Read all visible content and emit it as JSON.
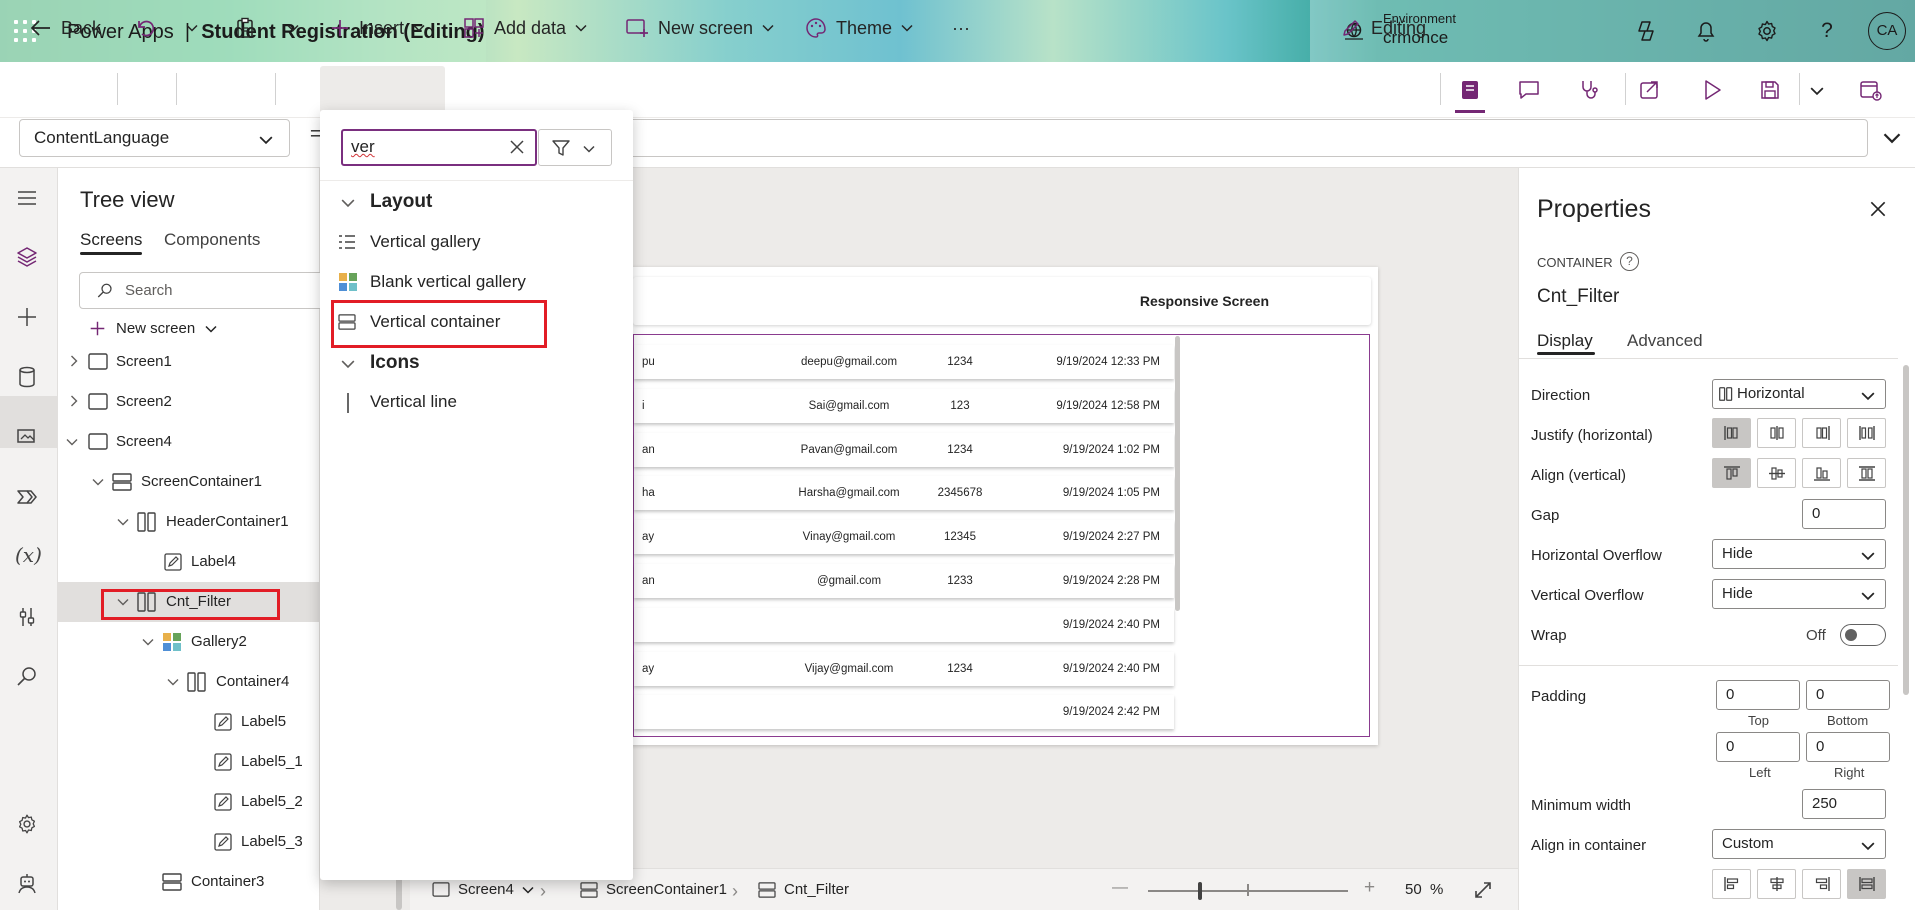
{
  "header": {
    "app_name": "Power Apps",
    "separator": "|",
    "doc_title": "Student Registration (Editing)",
    "environment_label": "Environment",
    "environment_name": "crmonce",
    "avatar_initials": "CA",
    "icons": [
      "app-launcher-icon",
      "environment-icon",
      "copilot-icon",
      "bell-icon",
      "gear-icon",
      "help-icon"
    ]
  },
  "commandbar": {
    "back": "Back",
    "insert": "Insert",
    "add_data": "Add data",
    "new_screen": "New screen",
    "theme": "Theme",
    "more": "···",
    "editing": "Editing"
  },
  "formula": {
    "property": "ContentLanguage",
    "equals": "="
  },
  "tree": {
    "title": "Tree view",
    "tabs": [
      "Screens",
      "Components"
    ],
    "search_placeholder": "Search",
    "new_screen": "New screen",
    "nodes": [
      {
        "label": "Screen1"
      },
      {
        "label": "Screen2"
      },
      {
        "label": "Screen4"
      },
      {
        "label": "ScreenContainer1"
      },
      {
        "label": "HeaderContainer1"
      },
      {
        "label": "Label4"
      },
      {
        "label": "Cnt_Filter"
      },
      {
        "label": "Gallery2"
      },
      {
        "label": "Container4"
      },
      {
        "label": "Label5"
      },
      {
        "label": "Label5_1"
      },
      {
        "label": "Label5_2"
      },
      {
        "label": "Label5_3"
      },
      {
        "label": "Container3"
      }
    ]
  },
  "insert_panel": {
    "search_value": "ver",
    "sections": [
      {
        "title": "Layout",
        "items": [
          "Vertical gallery",
          "Blank vertical gallery",
          "Vertical container"
        ]
      },
      {
        "title": "Icons",
        "items": [
          "Vertical line"
        ]
      }
    ]
  },
  "canvas": {
    "screen_title": "Responsive Screen",
    "rows": [
      {
        "name": "pu",
        "email": "deepu@gmail.com",
        "code": "1234",
        "date": "9/19/2024 12:33 PM"
      },
      {
        "name": "i",
        "email": "Sai@gmail.com",
        "code": "123",
        "date": "9/19/2024 12:58 PM"
      },
      {
        "name": "an",
        "email": "Pavan@gmail.com",
        "code": "1234",
        "date": "9/19/2024 1:02 PM"
      },
      {
        "name": "ha",
        "email": "Harsha@gmail.com",
        "code": "2345678",
        "date": "9/19/2024 1:05 PM"
      },
      {
        "name": "ay",
        "email": "Vinay@gmail.com",
        "code": "12345",
        "date": "9/19/2024 2:27 PM"
      },
      {
        "name": "an",
        "email": "@gmail.com",
        "code": "1233",
        "date": "9/19/2024 2:28 PM"
      },
      {
        "name": "",
        "email": "",
        "code": "",
        "date": "9/19/2024 2:40 PM"
      },
      {
        "name": "ay",
        "email": "Vijay@gmail.com",
        "code": "1234",
        "date": "9/19/2024 2:40 PM"
      },
      {
        "name": "",
        "email": "",
        "code": "",
        "date": "9/19/2024 2:42 PM"
      }
    ]
  },
  "footer": {
    "screen": "Screen4",
    "container": "ScreenContainer1",
    "control": "Cnt_Filter",
    "zoom_minus": "—",
    "zoom_plus": "+",
    "zoom_value": "50",
    "zoom_unit": "%"
  },
  "properties": {
    "title": "Properties",
    "type": "CONTAINER",
    "name": "Cnt_Filter",
    "tabs": [
      "Display",
      "Advanced"
    ],
    "direction_label": "Direction",
    "direction_value": "Horizontal",
    "justify_label": "Justify (horizontal)",
    "align_label": "Align (vertical)",
    "gap_label": "Gap",
    "gap_value": "0",
    "hoverflow_label": "Horizontal Overflow",
    "hoverflow_value": "Hide",
    "voverflow_label": "Vertical Overflow",
    "voverflow_value": "Hide",
    "wrap_label": "Wrap",
    "wrap_value": "Off",
    "padding_label": "Padding",
    "padding": {
      "top": "0",
      "bottom": "0",
      "left": "0",
      "right": "0"
    },
    "padding_captions": {
      "top": "Top",
      "bottom": "Bottom",
      "left": "Left",
      "right": "Right"
    },
    "minwidth_label": "Minimum width",
    "minwidth_value": "250",
    "align_in_container_label": "Align in container",
    "align_in_container_value": "Custom"
  },
  "colors": {
    "accent": "#742774",
    "highlight": "#e21d26",
    "selection": "#e1dfdd"
  }
}
